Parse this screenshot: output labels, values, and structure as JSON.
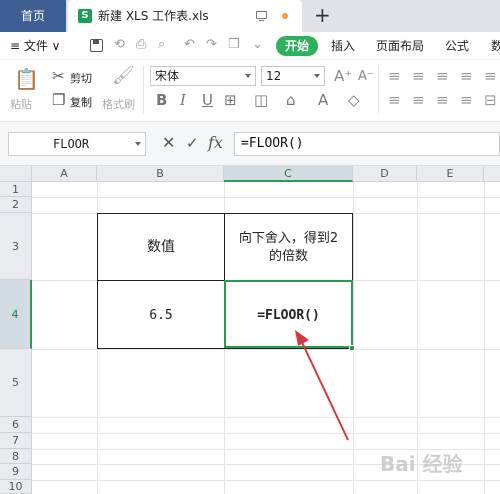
{
  "titlebar": {
    "home_tab": "首页",
    "doc_tab_icon": "S",
    "doc_tab": "新建 XLS 工作表.xls",
    "new_tab": "+"
  },
  "menu": {
    "file": "≡ 文件 ∨",
    "start": "开始",
    "items": [
      "插入",
      "页面布局",
      "公式",
      "数"
    ]
  },
  "toolbar": {
    "paste": "粘贴",
    "cut": "剪切",
    "copy": "复制",
    "format_painter": "格式刷",
    "font_name": "宋体",
    "font_size": "12",
    "bold": "B",
    "italic": "I",
    "underline": "U",
    "grow_font": "A⁺",
    "shrink_font": "A⁻"
  },
  "formula_bar": {
    "name_box": "FLOOR",
    "cancel": "✕",
    "confirm": "✓",
    "fx": "fx",
    "formula": "=FLOOR()"
  },
  "grid": {
    "columns": [
      "A",
      "B",
      "C",
      "D",
      "E"
    ],
    "rows": [
      "1",
      "2",
      "3",
      "4",
      "5",
      "6",
      "7",
      "8",
      "9",
      "10"
    ],
    "selected_column": "C",
    "selected_row": "4"
  },
  "cells": {
    "B3": "数值",
    "C3_line1": "向下舍入，得到2",
    "C3_line2": "的倍数",
    "B4": "6.5",
    "C4": "=FLOOR()"
  },
  "annotation_color": "#d33a3a",
  "watermark": "Bai 经验"
}
